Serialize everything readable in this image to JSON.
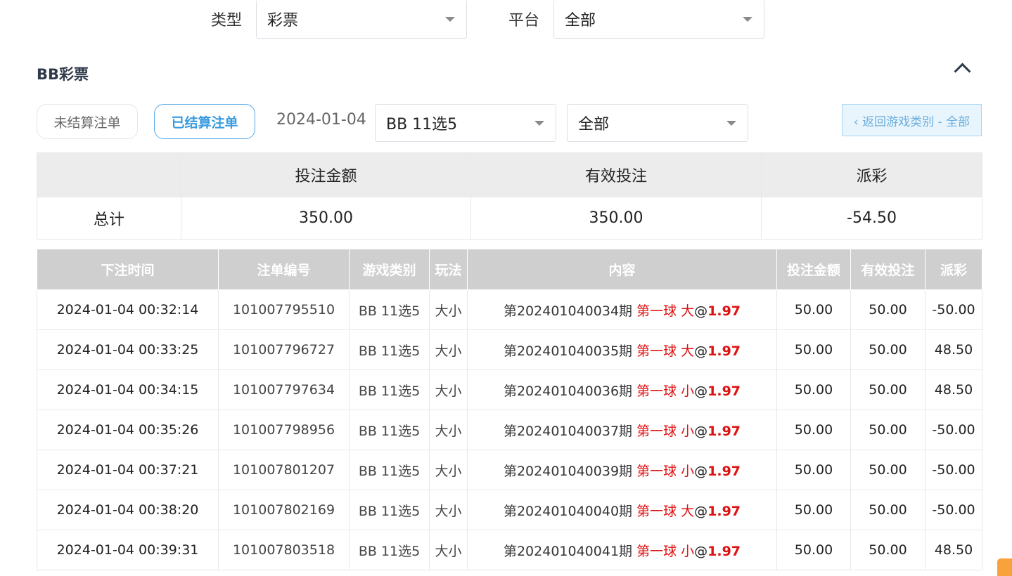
{
  "filters": {
    "type_label": "类型",
    "type_value": "彩票",
    "platform_label": "平台",
    "platform_value": "全部"
  },
  "section": {
    "title": "BB彩票"
  },
  "toolbar": {
    "unsettled_label": "未结算注单",
    "settled_label": "已结算注单",
    "date": "2024-01-04",
    "game_select": "BB 11选5",
    "scope_select": "全部",
    "back_label": "‹ 返回游戏类别 - 全部"
  },
  "summary": {
    "headers": [
      "",
      "投注金额",
      "有效投注",
      "派彩"
    ],
    "row": {
      "label": "总计",
      "bet": "350.00",
      "valid": "350.00",
      "payout": "-54.50"
    }
  },
  "table": {
    "headers": [
      "下注时间",
      "注单编号",
      "游戏类别",
      "玩法",
      "内容",
      "投注金额",
      "有效投注",
      "派彩"
    ],
    "rows": [
      {
        "time": "2024-01-04 00:32:14",
        "id": "101007795510",
        "game": "BB 11选5",
        "play": "大小",
        "issue": "第202401040034期",
        "pick": "第一球 大",
        "at": "@",
        "odds": "1.97",
        "bet": "50.00",
        "valid": "50.00",
        "payout": "-50.00"
      },
      {
        "time": "2024-01-04 00:33:25",
        "id": "101007796727",
        "game": "BB 11选5",
        "play": "大小",
        "issue": "第202401040035期",
        "pick": "第一球 大",
        "at": "@",
        "odds": "1.97",
        "bet": "50.00",
        "valid": "50.00",
        "payout": "48.50"
      },
      {
        "time": "2024-01-04 00:34:15",
        "id": "101007797634",
        "game": "BB 11选5",
        "play": "大小",
        "issue": "第202401040036期",
        "pick": "第一球 小",
        "at": "@",
        "odds": "1.97",
        "bet": "50.00",
        "valid": "50.00",
        "payout": "48.50"
      },
      {
        "time": "2024-01-04 00:35:26",
        "id": "101007798956",
        "game": "BB 11选5",
        "play": "大小",
        "issue": "第202401040037期",
        "pick": "第一球 小",
        "at": "@",
        "odds": "1.97",
        "bet": "50.00",
        "valid": "50.00",
        "payout": "-50.00"
      },
      {
        "time": "2024-01-04 00:37:21",
        "id": "101007801207",
        "game": "BB 11选5",
        "play": "大小",
        "issue": "第202401040039期",
        "pick": "第一球 小",
        "at": "@",
        "odds": "1.97",
        "bet": "50.00",
        "valid": "50.00",
        "payout": "-50.00"
      },
      {
        "time": "2024-01-04 00:38:20",
        "id": "101007802169",
        "game": "BB 11选5",
        "play": "大小",
        "issue": "第202401040040期",
        "pick": "第一球 大",
        "at": "@",
        "odds": "1.97",
        "bet": "50.00",
        "valid": "50.00",
        "payout": "-50.00"
      },
      {
        "time": "2024-01-04 00:39:31",
        "id": "101007803518",
        "game": "BB 11选5",
        "play": "大小",
        "issue": "第202401040041期",
        "pick": "第一球 小",
        "at": "@",
        "odds": "1.97",
        "bet": "50.00",
        "valid": "50.00",
        "payout": "48.50"
      }
    ]
  },
  "colors": {
    "negative": "#e15454",
    "highlight": "#e01010",
    "accent": "#3a9be0"
  }
}
